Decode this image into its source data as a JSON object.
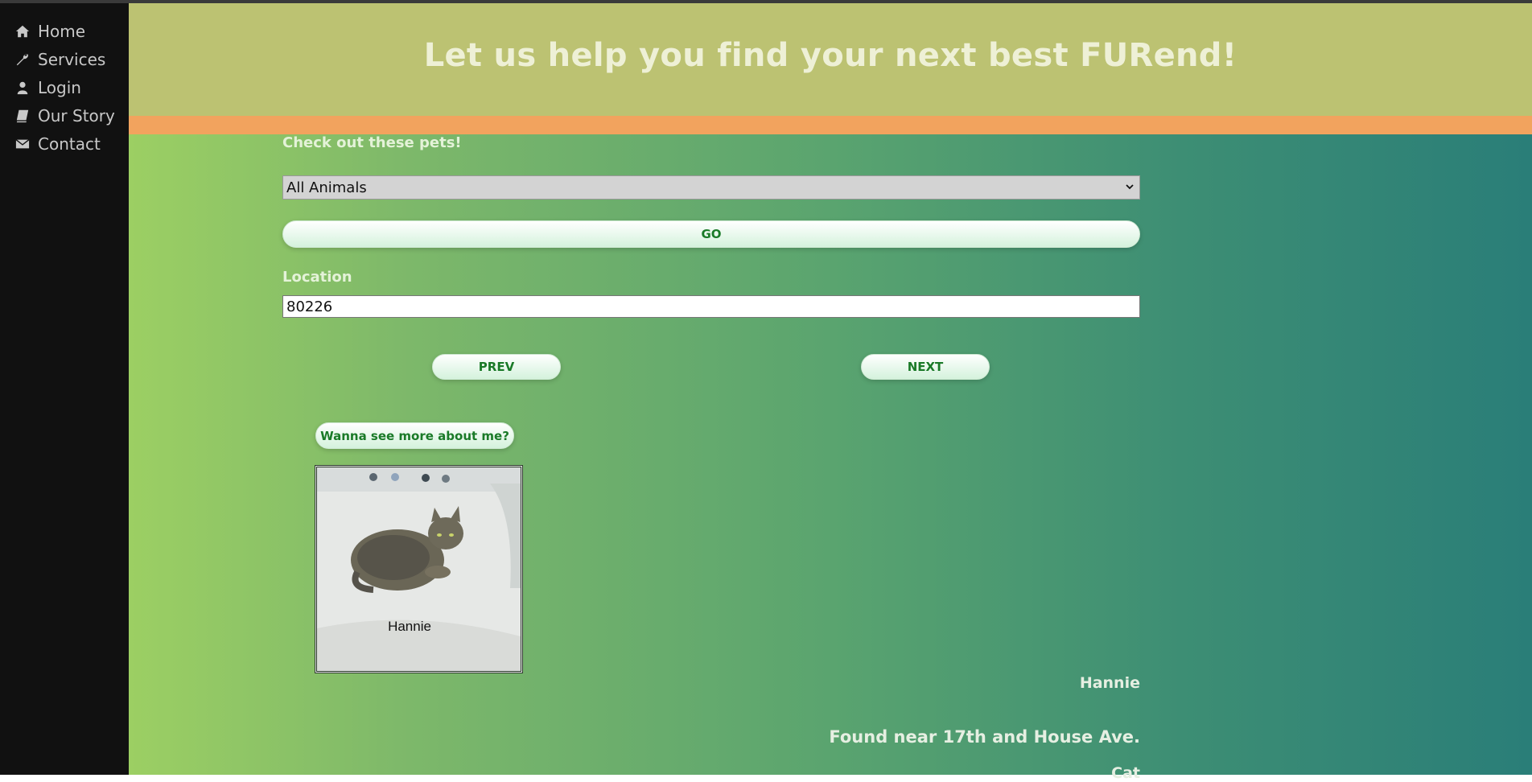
{
  "nav": {
    "items": [
      {
        "label": "Home",
        "icon": "home-icon"
      },
      {
        "label": "Services",
        "icon": "wrench-icon"
      },
      {
        "label": "Login",
        "icon": "user-icon"
      },
      {
        "label": "Our Story",
        "icon": "book-icon"
      },
      {
        "label": "Contact",
        "icon": "envelope-icon"
      }
    ]
  },
  "header": {
    "title": "Let us help you find your next best FURend!"
  },
  "search": {
    "heading": "Check out these pets!",
    "animal_select_value": "All Animals",
    "go_label": "GO",
    "location_label": "Location",
    "location_value": "80226"
  },
  "pager": {
    "prev_label": "PREV",
    "next_label": "NEXT"
  },
  "pet": {
    "more_label": "Wanna see more about me?",
    "photo_caption": "Hannie",
    "name": "Hannie",
    "description": "Found near 17th and House Ave.",
    "type": "Cat"
  },
  "colors": {
    "sidebar": "#111111",
    "header": "#bcc272",
    "stripe": "#f2a35e",
    "gradient_start": "#9ccf63",
    "gradient_end": "#2a7e78",
    "button_text": "#1a7a28"
  }
}
